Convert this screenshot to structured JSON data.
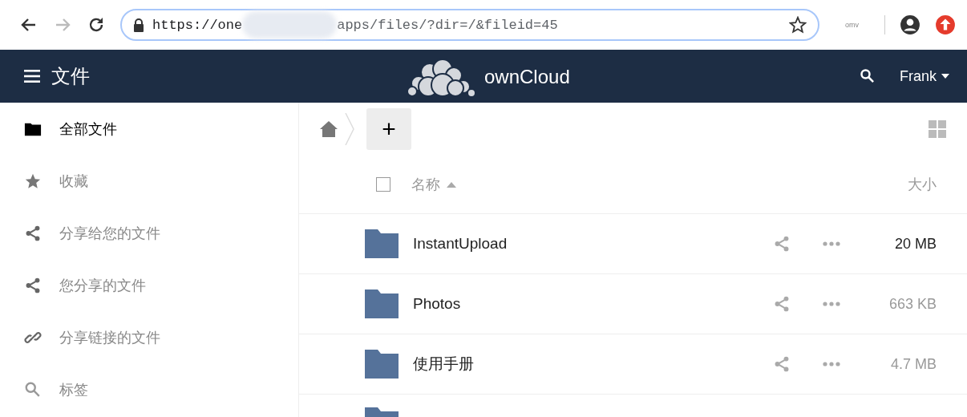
{
  "browser": {
    "url_start": "https://one",
    "url_end": "apps/files/?dir=/&fileid=45",
    "url_redacted": true,
    "bookmarked": false,
    "extension_label": "omv"
  },
  "header": {
    "app_title": "文件",
    "brand": "ownCloud",
    "user": "Frank"
  },
  "sidebar": {
    "items": [
      {
        "label": "全部文件",
        "kind": "folder",
        "selected": true
      },
      {
        "label": "收藏",
        "kind": "star",
        "selected": false
      },
      {
        "label": "分享给您的文件",
        "kind": "share",
        "selected": false
      },
      {
        "label": "您分享的文件",
        "kind": "share",
        "selected": false
      },
      {
        "label": "分享链接的文件",
        "kind": "link",
        "selected": false
      },
      {
        "label": "标签",
        "kind": "search",
        "selected": false
      }
    ]
  },
  "toolbar": {
    "new_button": "+"
  },
  "table": {
    "select_all_checked": false,
    "columns": {
      "name": "名称",
      "size": "大小"
    },
    "rows": [
      {
        "kind": "folder",
        "name": "InstantUpload",
        "size": "20 MB",
        "color": "#222222"
      },
      {
        "kind": "folder",
        "name": "Photos",
        "size": "663 KB",
        "color": "#999999"
      },
      {
        "kind": "folder",
        "name": "使用手册",
        "size": "4.7 MB",
        "color": "#999999"
      }
    ],
    "cut_off_row": {
      "kind": "folder"
    }
  }
}
